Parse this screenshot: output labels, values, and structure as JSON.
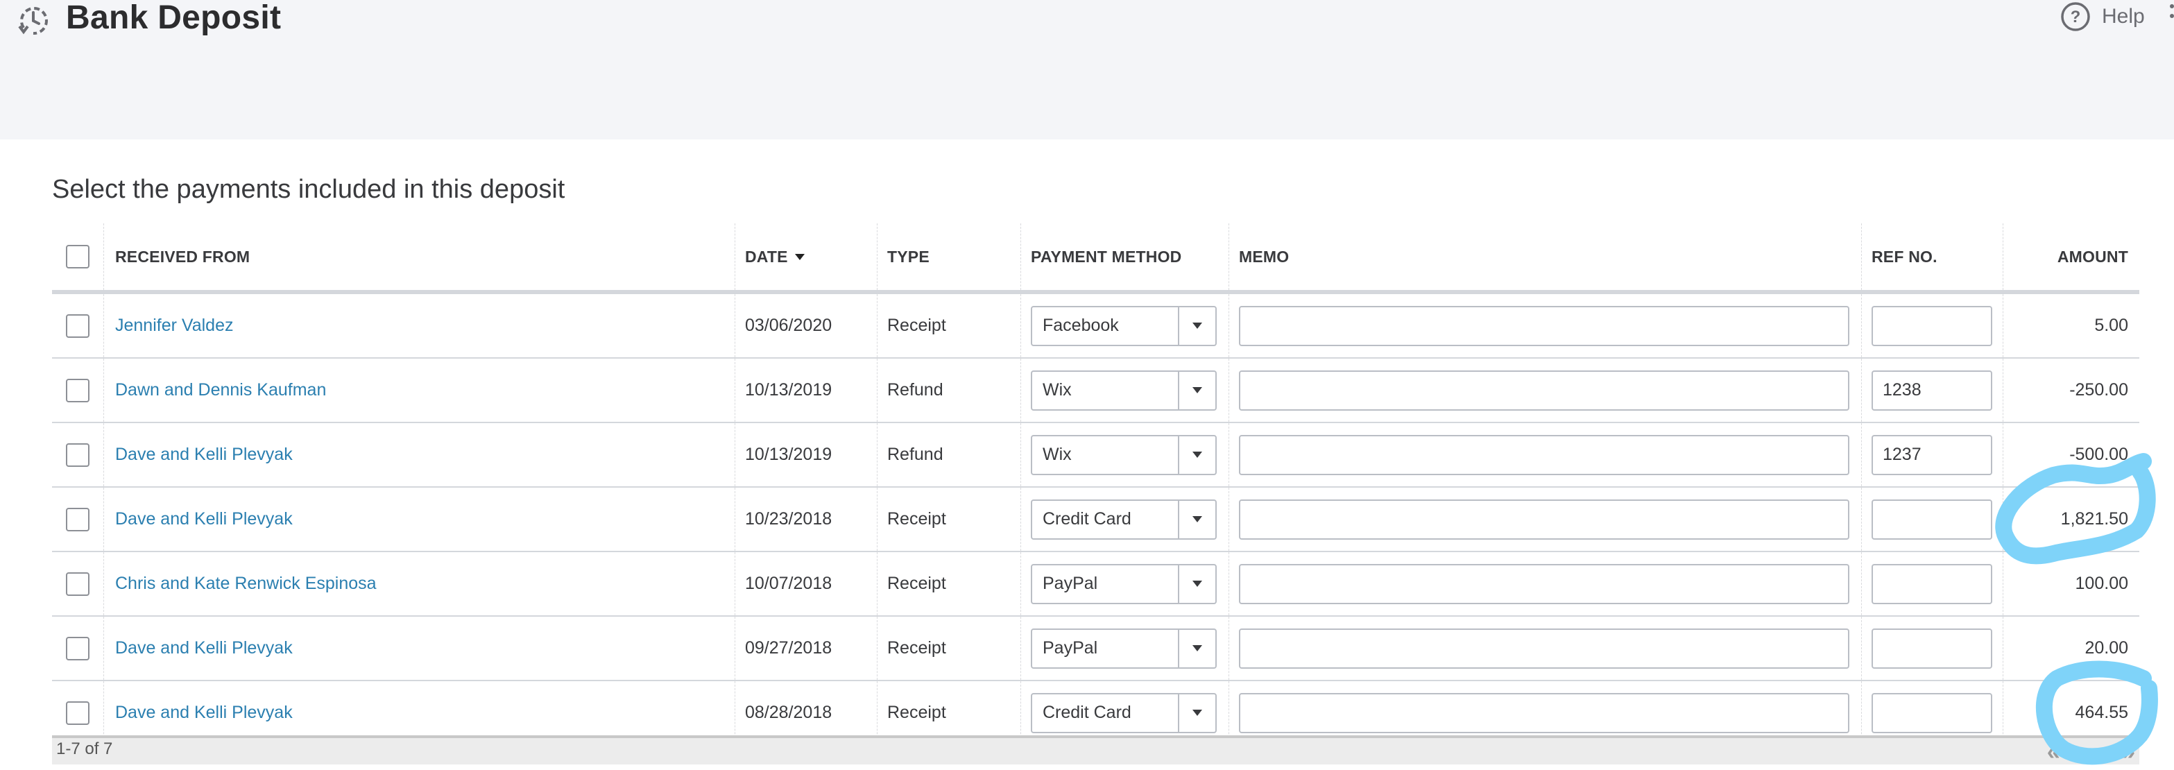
{
  "header": {
    "title": "Bank Deposit",
    "help_label": "Help",
    "icons": {
      "page": "recent-transactions-icon",
      "help": "help-circle-icon",
      "overflow": "more-options-icon"
    }
  },
  "section_title": "Select the payments included in this deposit",
  "table": {
    "columns": {
      "received_from": "RECEIVED FROM",
      "date": "DATE",
      "type": "TYPE",
      "payment_method": "PAYMENT METHOD",
      "memo": "MEMO",
      "ref_no": "REF NO.",
      "amount": "AMOUNT"
    },
    "sort": {
      "column": "date",
      "direction": "descending"
    },
    "rows": [
      {
        "checked": false,
        "received_from": "Jennifer Valdez",
        "date": "03/06/2020",
        "type": "Receipt",
        "payment_method": "Facebook",
        "memo": "",
        "ref_no": "",
        "amount": "5.00"
      },
      {
        "checked": false,
        "received_from": "Dawn and Dennis Kaufman",
        "date": "10/13/2019",
        "type": "Refund",
        "payment_method": "Wix",
        "memo": "",
        "ref_no": "1238",
        "amount": "-250.00"
      },
      {
        "checked": false,
        "received_from": "Dave and Kelli Plevyak",
        "date": "10/13/2019",
        "type": "Refund",
        "payment_method": "Wix",
        "memo": "",
        "ref_no": "1237",
        "amount": "-500.00"
      },
      {
        "checked": false,
        "received_from": "Dave and Kelli Plevyak",
        "date": "10/23/2018",
        "type": "Receipt",
        "payment_method": "Credit Card",
        "memo": "",
        "ref_no": "",
        "amount": "1,821.50"
      },
      {
        "checked": false,
        "received_from": "Chris and Kate Renwick Espinosa",
        "date": "10/07/2018",
        "type": "Receipt",
        "payment_method": "PayPal",
        "memo": "",
        "ref_no": "",
        "amount": "100.00"
      },
      {
        "checked": false,
        "received_from": "Dave and Kelli Plevyak",
        "date": "09/27/2018",
        "type": "Receipt",
        "payment_method": "PayPal",
        "memo": "",
        "ref_no": "",
        "amount": "20.00"
      },
      {
        "checked": false,
        "received_from": "Dave and Kelli Plevyak",
        "date": "08/28/2018",
        "type": "Receipt",
        "payment_method": "Credit Card",
        "memo": "",
        "ref_no": "",
        "amount": "464.55"
      }
    ]
  },
  "footer": {
    "count_label": "1-7 of 7",
    "first_page": "«",
    "last_page": "»"
  },
  "annotations": {
    "color": "#7fd3f9",
    "circled_amounts": [
      "1,821.50",
      "464.55"
    ]
  }
}
